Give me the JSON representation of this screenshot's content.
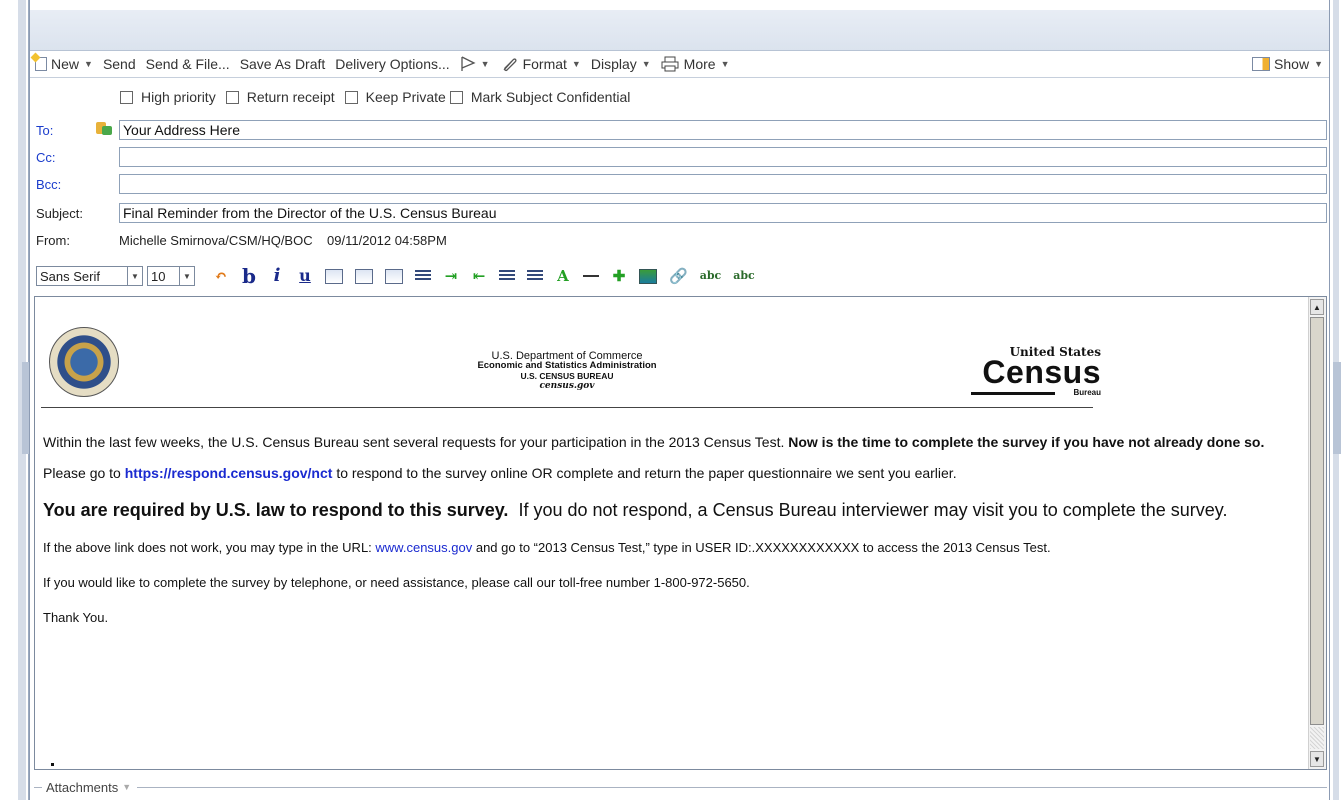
{
  "toolbar": {
    "new": "New",
    "send": "Send",
    "send_file": "Send & File...",
    "save_draft": "Save As Draft",
    "delivery": "Delivery Options...",
    "format": "Format",
    "display": "Display",
    "more": "More",
    "show": "Show"
  },
  "options": {
    "high_priority": "High priority",
    "return_receipt": "Return receipt",
    "keep_private": "Keep Private",
    "mark_confidential": "Mark Subject Confidential"
  },
  "fields": {
    "to_label": "To:",
    "to_value": "Your Address Here",
    "cc_label": "Cc:",
    "cc_value": "",
    "bcc_label": "Bcc:",
    "bcc_value": "",
    "subject_label": "Subject:",
    "subject_value": "Final Reminder from the Director of the U.S. Census Bureau",
    "from_label": "From:",
    "from_value": "Michelle Smirnova/CSM/HQ/BOC    09/11/2012 04:58PM"
  },
  "format_bar": {
    "font": "Sans Serif",
    "size": "10"
  },
  "letterhead": {
    "line1": "U.S. Department of Commerce",
    "line2": "Economic and Statistics Administration",
    "line3": "U.S. CENSUS BUREAU",
    "line4": "census.gov",
    "logo_top": "United States",
    "logo_main": "Census",
    "logo_sub": "Bureau"
  },
  "body": {
    "p1_text": "Within the last few weeks, the U.S. Census Bureau sent several requests for your participation in the 2013 Census Test. ",
    "p1_bold": "Now is the time to complete the survey if you have not already done so.",
    "p2_pre": "Please go to ",
    "p2_link": "https://respond.census.gov/nct",
    "p2_post": " to respond to the survey online OR complete and return the paper questionnaire we sent you earlier.",
    "p3_bold": "You are required by U.S. law to respond to this survey.",
    "p3_text": "  If you do not respond, a Census Bureau interviewer may visit you to complete the survey.",
    "p4_pre": "If the above link does not work, you may type in the URL: ",
    "p4_link": "www.census.gov",
    "p4_post": " and go to “2013 Census Test,” type in USER ID:.XXXXXXXXXXXX to access the 2013 Census Test.",
    "p5": "If you would like to complete the survey by telephone, or need assistance, please call our toll-free number 1-800-972-5650.",
    "p6": "Thank You."
  },
  "attachments_label": "Attachments",
  "colors": {
    "field_label": "#1a3ccc",
    "link": "#1a2ad0",
    "header_band": "#dbe3ee"
  }
}
